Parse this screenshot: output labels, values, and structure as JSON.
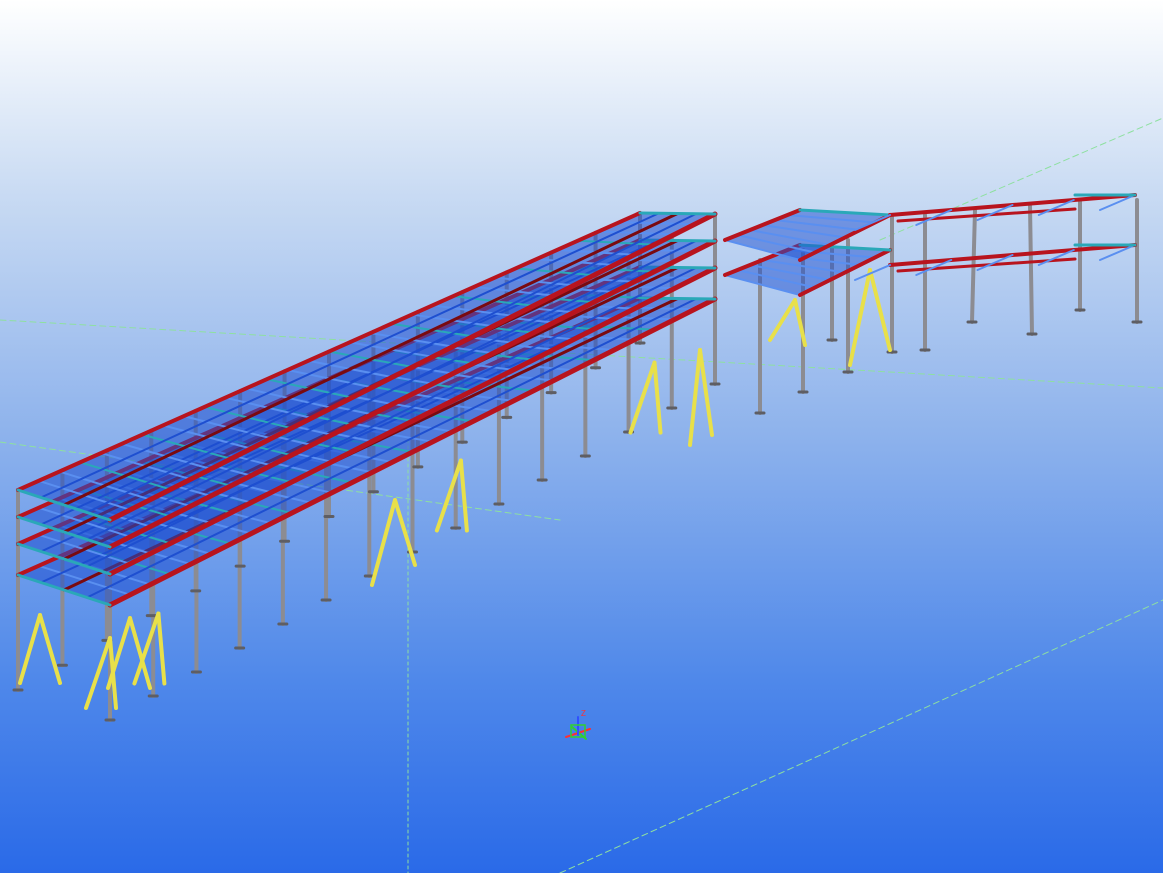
{
  "viewport": {
    "background_top": "#ffffff",
    "background_bottom": "#2a6ae8"
  },
  "model": {
    "members": {
      "beam_color": "#b8141e",
      "beam_dark": "#7a0a10",
      "joist_color": "#1e4fd0",
      "joist_light": "#5a8ff0",
      "brace_color": "#2aa8b8",
      "column_color": "#8c8c92",
      "column_dark": "#5e5e64",
      "bracing_color": "#e8e04a"
    },
    "grid_line_color": "#8ee0a0"
  },
  "axis_gizmo": {
    "x_color": "#ff3030",
    "y_color": "#30d030",
    "z_color": "#3050ff",
    "label": "Z"
  }
}
